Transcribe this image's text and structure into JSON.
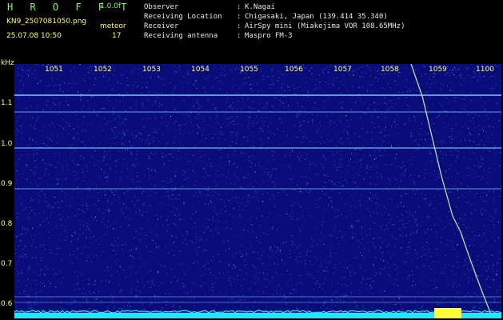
{
  "header": {
    "title": "H R O F F T",
    "version": "1.0.0f",
    "filename": "KN9_2507081050.png",
    "timestamp": "25.07.08 10:50",
    "meteor_label": "meteor",
    "meteor_count": "17"
  },
  "meta": {
    "observer_label": "Observer",
    "observer_value": "K.Nagai",
    "location_label": "Receiving Location",
    "location_value": "Chigasaki, Japan (139.414 35.340)",
    "receiver_label": "Receiver",
    "receiver_value": "AirSpy mini (Miakejima VOR 108.65MHz)",
    "antenna_label": "Receiving antenna",
    "antenna_value": "Maspro FM-3",
    "colon": ":"
  },
  "axes": {
    "y_unit": "kHz",
    "y_ticks": [
      "1.1",
      "1.0",
      "0.9",
      "0.8",
      "0.7",
      "0.6"
    ],
    "x_ticks": [
      "1051",
      "1052",
      "1053",
      "1054",
      "1055",
      "1056",
      "1057",
      "1058",
      "1059",
      "1100"
    ]
  },
  "colors": {
    "background": "#0a0c7a",
    "noise": "#3a7bff",
    "trace": "#7fd7ff",
    "baseline": "#22e6ff",
    "burst": "#ffff33",
    "label_green": "#7cff5a",
    "label_yellow": "#ffff66"
  }
}
